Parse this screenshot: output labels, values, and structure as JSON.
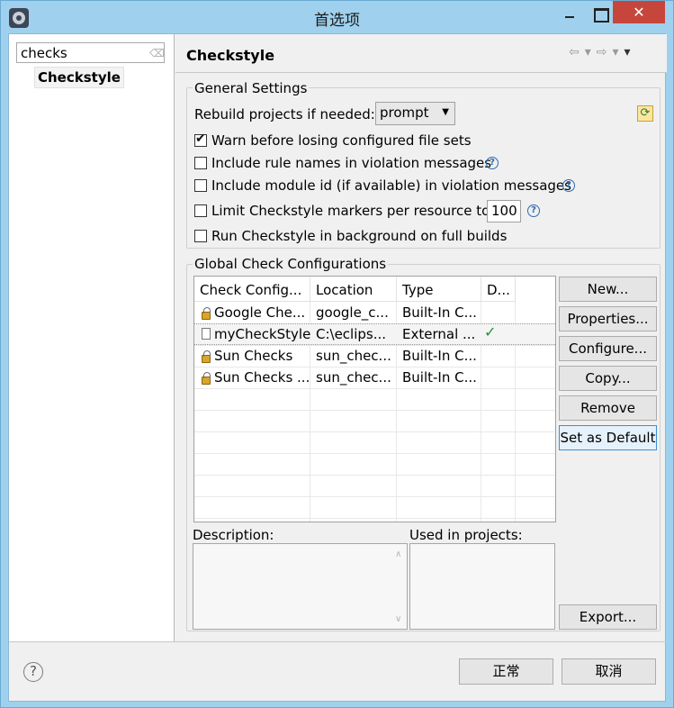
{
  "window": {
    "title": "首选项",
    "close_glyph": "✕"
  },
  "nav": {
    "filter_value": "checks",
    "items": [
      {
        "label": "Checkstyle",
        "selected": true
      }
    ]
  },
  "page": {
    "title": "Checkstyle",
    "nav_arrows": [
      "⇦",
      "▾",
      "⇨",
      "▾",
      "▾"
    ]
  },
  "general": {
    "title": "General Settings",
    "rebuild_label": "Rebuild projects if needed:",
    "rebuild_value": "prompt",
    "options": [
      {
        "label": "Warn before losing configured file sets",
        "checked": true,
        "help": false
      },
      {
        "label": "Include rule names in violation messages",
        "checked": false,
        "help": true
      },
      {
        "label": "Include module id (if available) in violation messages",
        "checked": false,
        "help": true
      },
      {
        "label": "Limit Checkstyle markers per resource to",
        "checked": false,
        "help": true,
        "value": "100"
      },
      {
        "label": "Run Checkstyle in background on full builds",
        "checked": false,
        "help": false
      }
    ]
  },
  "global": {
    "title": "Global Check Configurations",
    "columns": [
      "Check Config...",
      "Location",
      "Type",
      "D..."
    ],
    "rows": [
      {
        "name": "Google Che...",
        "location": "google_c...",
        "type": "Built-In C...",
        "default": "",
        "icon": "lock-icon"
      },
      {
        "name": "myCheckStyle",
        "location": "C:\\eclips...",
        "type": "External ...",
        "default": "✓",
        "icon": "file-icon"
      },
      {
        "name": "Sun Checks",
        "location": "sun_chec...",
        "type": "Built-In C...",
        "default": "",
        "icon": "lock-icon"
      },
      {
        "name": "Sun Checks ...",
        "location": "sun_chec...",
        "type": "Built-In C...",
        "default": "",
        "icon": "lock-icon"
      }
    ],
    "buttons": {
      "new": "New...",
      "properties": "Properties...",
      "configure": "Configure...",
      "copy": "Copy...",
      "remove": "Remove",
      "set_default": "Set as Default",
      "export": "Export..."
    },
    "description_label": "Description:",
    "used_label": "Used in projects:"
  },
  "footer": {
    "help_glyph": "?",
    "ok": "正常",
    "cancel": "取消"
  }
}
